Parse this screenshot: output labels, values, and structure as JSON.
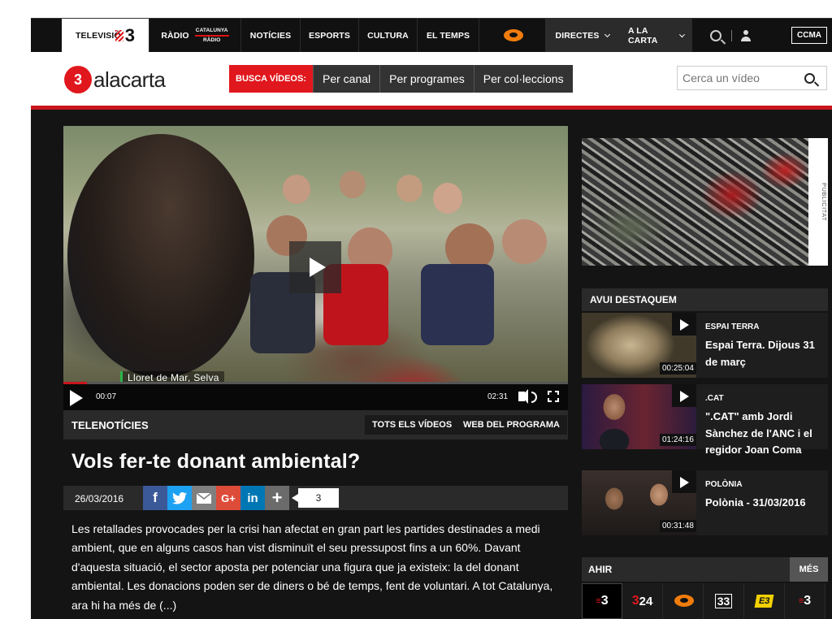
{
  "nav": {
    "tv": "TELEVISIÓ",
    "tv_logo": "3",
    "radio": "RÀDIO",
    "radio_logo_top": "CATALUNYA",
    "radio_logo_bottom": "RÀDIO",
    "items": [
      "NOTÍCIES",
      "ESPORTS",
      "CULTURA",
      "EL TEMPS"
    ],
    "directes": "DIRECTES",
    "carta": "A LA CARTA",
    "ccma": "CCMA"
  },
  "header": {
    "brand_number": "3",
    "brand_text": "alacarta",
    "busca_label": "BUSCA VÍDEOS:",
    "options": [
      "Per canal",
      "Per programes",
      "Per col·leccions"
    ],
    "search_placeholder": "Cerca un vídeo"
  },
  "video": {
    "caption": "Lloret de Mar, Selva",
    "current": "00:07",
    "duration": "02:31",
    "progress": 0.046
  },
  "program": {
    "name": "TELENOTÍCIES",
    "all_videos": "TOTS ELS VÍDEOS",
    "web": "WEB DEL PROGRAMA"
  },
  "article": {
    "title": "Vols fer-te donant ambiental?",
    "date": "26/03/2016",
    "share_count": "3",
    "description": "Les retallades provocades per la crisi han afectat en gran part les partides destinades a medi ambient, que en alguns casos han vist disminuït el seu pressupost fins a un 60%. Davant d'aquesta situació, el sector aposta per potenciar una figura que ja existeix: la del donant ambiental. Les donacions poden ser de diners o bé de temps, fent de voluntari. A tot Catalunya, ara hi ha més de (...)"
  },
  "share_icons": [
    "facebook-icon",
    "twitter-icon",
    "email-icon",
    "google-plus-icon",
    "linkedin-icon",
    "more-icon"
  ],
  "ad_label": "PUBLICITAT",
  "featured": {
    "heading": "AVUI DESTAQUEM",
    "items": [
      {
        "category": "ESPAI TERRA",
        "title": "Espai Terra. Dijous 31 de març",
        "duration": "00:25:04"
      },
      {
        "category": ".CAT",
        "title": "\".CAT\" amb Jordi Sànchez de l'ANC i el regidor Joan Coma",
        "duration": "01:24:16"
      },
      {
        "category": "POLÒNIA",
        "title": "Polònia - 31/03/2016",
        "duration": "00:31:48"
      }
    ]
  },
  "ahir": {
    "heading": "AHIR",
    "more": "MÉS",
    "channels": [
      "3",
      "3/24",
      "Super3",
      "33",
      "Esport3",
      "3cat"
    ]
  },
  "colors": {
    "accent": "#e0171d",
    "dark": "#141414"
  }
}
